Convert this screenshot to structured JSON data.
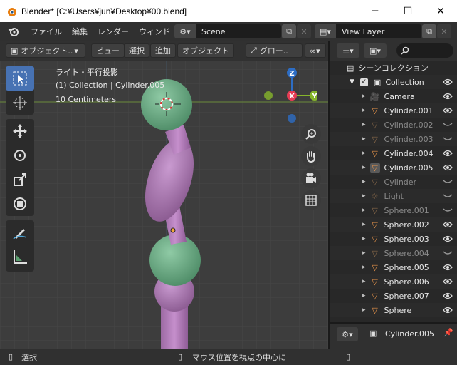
{
  "window": {
    "title": "Blender* [C:¥Users¥jun¥Desktop¥00.blend]",
    "min_glyph": "─",
    "max_glyph": "☐",
    "close_glyph": "✕"
  },
  "menubar": {
    "items": [
      "ファイル",
      "編集",
      "レンダー",
      "ウィンド"
    ],
    "scene_name": "Scene",
    "view_layer_name": "View Layer"
  },
  "viewport_header": {
    "mode": "オブジェクト..",
    "menus": [
      "ビュー",
      "選択",
      "追加",
      "オブジェクト"
    ],
    "transform": "グロー.."
  },
  "viewport_info": {
    "line1": "ライト・平行投影",
    "line2": "(1) Collection | Cylinder.005",
    "line3": "10 Centimeters"
  },
  "gizmo": {
    "z": "Z",
    "x": "X",
    "y": "Y"
  },
  "outliner": {
    "root": "シーンコレクション",
    "collection": "Collection",
    "items": [
      {
        "label": "Camera",
        "type": "camera",
        "visible": true
      },
      {
        "label": "Cylinder.001",
        "type": "mesh",
        "visible": true
      },
      {
        "label": "Cylinder.002",
        "type": "mesh",
        "visible": false
      },
      {
        "label": "Cylinder.003",
        "type": "mesh",
        "visible": false
      },
      {
        "label": "Cylinder.004",
        "type": "mesh",
        "visible": true
      },
      {
        "label": "Cylinder.005",
        "type": "mesh",
        "visible": true,
        "active": true
      },
      {
        "label": "Cylinder",
        "type": "mesh",
        "visible": false
      },
      {
        "label": "Light",
        "type": "light",
        "visible": false
      },
      {
        "label": "Sphere.001",
        "type": "mesh",
        "visible": false
      },
      {
        "label": "Sphere.002",
        "type": "mesh",
        "visible": true
      },
      {
        "label": "Sphere.003",
        "type": "mesh",
        "visible": true
      },
      {
        "label": "Sphere.004",
        "type": "mesh",
        "visible": false
      },
      {
        "label": "Sphere.005",
        "type": "mesh",
        "visible": true
      },
      {
        "label": "Sphere.006",
        "type": "mesh",
        "visible": true
      },
      {
        "label": "Sphere.007",
        "type": "mesh",
        "visible": true
      },
      {
        "label": "Sphere",
        "type": "mesh",
        "visible": true
      }
    ]
  },
  "properties": {
    "object_name": "Cylinder.005"
  },
  "statusbar": {
    "left": "選択",
    "middle": "マウス位置を視点の中心に"
  },
  "colors": {
    "accent": "#4772b3",
    "mesh_icon": "#e8944a",
    "green_sphere": "#6fb089",
    "purple_body": "#b07ab6"
  }
}
